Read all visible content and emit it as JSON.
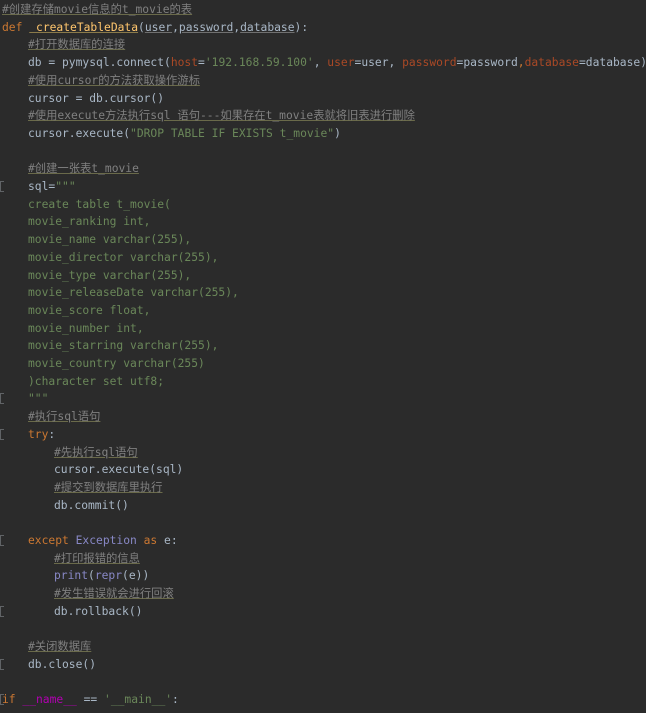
{
  "lines": [
    {
      "indent": 0,
      "tokens": [
        {
          "t": "#创建存储movie信息的t_movie的表",
          "c": "cmt"
        }
      ]
    },
    {
      "indent": 0,
      "tokens": [
        {
          "t": "def ",
          "c": "kw"
        },
        {
          "t": " createTableData",
          "c": "fn"
        },
        {
          "t": "(",
          "c": "plain"
        },
        {
          "t": "user",
          "c": "param"
        },
        {
          "t": ",",
          "c": "plain"
        },
        {
          "t": "password",
          "c": "param"
        },
        {
          "t": ",",
          "c": "plain"
        },
        {
          "t": "database",
          "c": "param"
        },
        {
          "t": "):",
          "c": "plain"
        }
      ]
    },
    {
      "indent": 1,
      "tokens": [
        {
          "t": "#打开数据库的连接",
          "c": "cmt"
        }
      ]
    },
    {
      "indent": 1,
      "tokens": [
        {
          "t": "db = pymysql.connect(",
          "c": "plain"
        },
        {
          "t": "host",
          "c": "kwarg"
        },
        {
          "t": "=",
          "c": "plain"
        },
        {
          "t": "'192.168.59.100'",
          "c": "str"
        },
        {
          "t": ", ",
          "c": "plain"
        },
        {
          "t": "user",
          "c": "kwarg"
        },
        {
          "t": "=user, ",
          "c": "plain"
        },
        {
          "t": "password",
          "c": "kwarg"
        },
        {
          "t": "=password",
          "c": "plain"
        },
        {
          "t": ",",
          "c": "kw"
        },
        {
          "t": "database",
          "c": "kwarg"
        },
        {
          "t": "=database)",
          "c": "plain"
        }
      ]
    },
    {
      "indent": 1,
      "tokens": [
        {
          "t": "#使用cursor的方法获取操作游标",
          "c": "cmt"
        }
      ]
    },
    {
      "indent": 1,
      "tokens": [
        {
          "t": "cursor = db.cursor()",
          "c": "plain"
        }
      ]
    },
    {
      "indent": 1,
      "tokens": [
        {
          "t": "#使用execute方法执行sql 语句---如果存在t_movie表就将旧表进行删除",
          "c": "cmt"
        }
      ]
    },
    {
      "indent": 1,
      "tokens": [
        {
          "t": "cursor.execute(",
          "c": "plain"
        },
        {
          "t": "\"DROP TABLE IF EXISTS t_movie\"",
          "c": "str"
        },
        {
          "t": ")",
          "c": "plain"
        }
      ]
    },
    {
      "indent": 0,
      "tokens": []
    },
    {
      "indent": 1,
      "tokens": [
        {
          "t": "#创建一张表t_movie",
          "c": "cmt"
        }
      ]
    },
    {
      "indent": 1,
      "mark": true,
      "tokens": [
        {
          "t": "sql",
          "c": "plain"
        },
        {
          "t": "=",
          "c": "plain"
        },
        {
          "t": "\"\"\"",
          "c": "str"
        }
      ]
    },
    {
      "indent": 1,
      "tokens": [
        {
          "t": "create table t_movie(",
          "c": "str"
        }
      ]
    },
    {
      "indent": 1,
      "tokens": [
        {
          "t": "movie_ranking int,",
          "c": "str"
        }
      ]
    },
    {
      "indent": 1,
      "tokens": [
        {
          "t": "movie_name varchar(255),",
          "c": "str"
        }
      ]
    },
    {
      "indent": 1,
      "tokens": [
        {
          "t": "movie_director varchar(255),",
          "c": "str"
        }
      ]
    },
    {
      "indent": 1,
      "tokens": [
        {
          "t": "movie_type varchar(255),",
          "c": "str"
        }
      ]
    },
    {
      "indent": 1,
      "tokens": [
        {
          "t": "movie_releaseDate varchar(255),",
          "c": "str"
        }
      ]
    },
    {
      "indent": 1,
      "tokens": [
        {
          "t": "movie_score float,",
          "c": "str"
        }
      ]
    },
    {
      "indent": 1,
      "tokens": [
        {
          "t": "movie_number int,",
          "c": "str"
        }
      ]
    },
    {
      "indent": 1,
      "tokens": [
        {
          "t": "movie_starring varchar(255),",
          "c": "str"
        }
      ]
    },
    {
      "indent": 1,
      "tokens": [
        {
          "t": "movie_country varchar(255)",
          "c": "str"
        }
      ]
    },
    {
      "indent": 1,
      "tokens": [
        {
          "t": ")character set utf8;",
          "c": "str"
        }
      ]
    },
    {
      "indent": 1,
      "mark": true,
      "tokens": [
        {
          "t": "\"\"\"",
          "c": "str"
        }
      ]
    },
    {
      "indent": 1,
      "tokens": [
        {
          "t": "#执行sql语句",
          "c": "cmt"
        }
      ]
    },
    {
      "indent": 1,
      "mark": true,
      "tokens": [
        {
          "t": "try",
          "c": "kw"
        },
        {
          "t": ":",
          "c": "plain"
        }
      ]
    },
    {
      "indent": 2,
      "tokens": [
        {
          "t": "#先执行sql语句",
          "c": "cmt"
        }
      ]
    },
    {
      "indent": 2,
      "tokens": [
        {
          "t": "cursor.execute(sql)",
          "c": "plain"
        }
      ]
    },
    {
      "indent": 2,
      "tokens": [
        {
          "t": "#提交到数据库里执行",
          "c": "cmt"
        }
      ]
    },
    {
      "indent": 2,
      "tokens": [
        {
          "t": "db.commit()",
          "c": "plain"
        }
      ]
    },
    {
      "indent": 0,
      "tokens": []
    },
    {
      "indent": 1,
      "mark": true,
      "tokens": [
        {
          "t": "except ",
          "c": "kw"
        },
        {
          "t": "Exception ",
          "c": "builtin"
        },
        {
          "t": "as ",
          "c": "kw"
        },
        {
          "t": "e:",
          "c": "plain"
        }
      ]
    },
    {
      "indent": 2,
      "tokens": [
        {
          "t": "#打印报错的信息",
          "c": "cmt"
        }
      ]
    },
    {
      "indent": 2,
      "tokens": [
        {
          "t": "print",
          "c": "builtin"
        },
        {
          "t": "(",
          "c": "plain"
        },
        {
          "t": "repr",
          "c": "builtin"
        },
        {
          "t": "(e))",
          "c": "plain"
        }
      ]
    },
    {
      "indent": 2,
      "tokens": [
        {
          "t": "#发生错误就会进行回滚",
          "c": "cmt"
        }
      ]
    },
    {
      "indent": 2,
      "mark": true,
      "tokens": [
        {
          "t": "db.rollback()",
          "c": "plain"
        }
      ]
    },
    {
      "indent": 0,
      "tokens": []
    },
    {
      "indent": 1,
      "tokens": [
        {
          "t": "#关闭数据库",
          "c": "cmt"
        }
      ]
    },
    {
      "indent": 1,
      "mark": true,
      "tokens": [
        {
          "t": "db.close()",
          "c": "plain"
        }
      ]
    },
    {
      "indent": 0,
      "tokens": []
    },
    {
      "indent": 0,
      "mark": true,
      "tokens": [
        {
          "t": "if ",
          "c": "kw"
        },
        {
          "t": "__name__ ",
          "c": "dunder"
        },
        {
          "t": "== ",
          "c": "plain"
        },
        {
          "t": "'__main__'",
          "c": "str"
        },
        {
          "t": ":",
          "c": "plain"
        }
      ]
    }
  ]
}
